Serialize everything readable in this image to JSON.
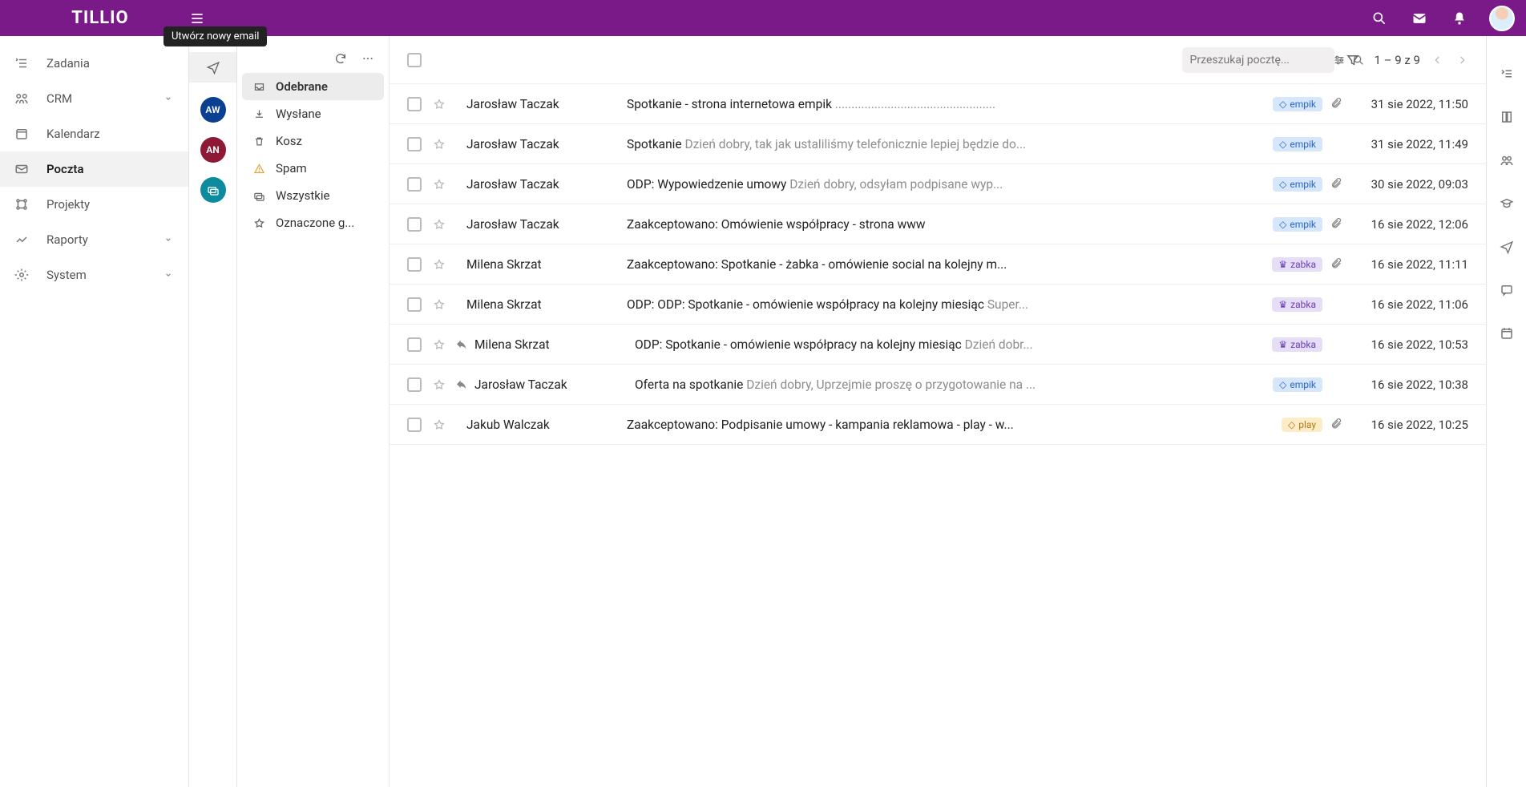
{
  "brand": "TILLIO",
  "tooltip": "Utwórz nowy email",
  "leftnav": [
    {
      "icon": "tasks",
      "label": "Zadania",
      "chev": false
    },
    {
      "icon": "crm",
      "label": "CRM",
      "chev": true
    },
    {
      "icon": "cal",
      "label": "Kalendarz",
      "chev": false
    },
    {
      "icon": "mail",
      "label": "Poczta",
      "chev": false,
      "active": true
    },
    {
      "icon": "proj",
      "label": "Projekty",
      "chev": false
    },
    {
      "icon": "rep",
      "label": "Raporty",
      "chev": true
    },
    {
      "icon": "sys",
      "label": "System",
      "chev": true
    }
  ],
  "accounts": [
    {
      "cls": "aw",
      "txt": "AW"
    },
    {
      "cls": "an",
      "txt": "AN"
    },
    {
      "cls": "mail",
      "txt": ""
    }
  ],
  "folders": [
    {
      "icon": "inbox",
      "label": "Odebrane",
      "active": true
    },
    {
      "icon": "sent",
      "label": "Wysłane"
    },
    {
      "icon": "trash",
      "label": "Kosz"
    },
    {
      "icon": "spam",
      "label": "Spam",
      "cls": "spam"
    },
    {
      "icon": "all",
      "label": "Wszystkie"
    },
    {
      "icon": "star",
      "label": "Oznaczone g..."
    }
  ],
  "search_placeholder": "Przeszukaj pocztę...",
  "pager": "1 – 9 z 9",
  "tags": {
    "empik": "empik",
    "zabka": "zabka",
    "play": "play"
  },
  "rows": [
    {
      "sender": "Jarosław Taczak",
      "subject": "Spotkanie - strona internetowa empik ",
      "preview": ".................................................",
      "tag": "empik",
      "clip": true,
      "date": "31 sie 2022, 11:50"
    },
    {
      "sender": "Jarosław Taczak",
      "subject": "Spotkanie ",
      "preview": "Dzień dobry, tak jak ustaliliśmy telefonicznie lepiej będzie do...",
      "tag": "empik",
      "clip": false,
      "date": "31 sie 2022, 11:49"
    },
    {
      "sender": "Jarosław Taczak",
      "subject": "ODP: Wypowiedzenie umowy ",
      "preview": "Dzień dobry, odsyłam podpisane wyp...",
      "tag": "empik",
      "clip": true,
      "date": "30 sie 2022, 09:03"
    },
    {
      "sender": "Jarosław Taczak",
      "subject": "Zaakceptowano: Omówienie współpracy - strona www",
      "preview": "",
      "tag": "empik",
      "clip": true,
      "date": "16 sie 2022, 12:06"
    },
    {
      "sender": "Milena Skrzat",
      "subject": "Zaakceptowano: Spotkanie - żabka - omówienie social na kolejny m...",
      "preview": "",
      "tag": "zabka",
      "clip": true,
      "date": "16 sie 2022, 11:11"
    },
    {
      "sender": "Milena Skrzat",
      "subject": "ODP: ODP: Spotkanie - omówienie współpracy na kolejny miesiąc ",
      "preview": "Super...",
      "tag": "zabka",
      "clip": false,
      "date": "16 sie 2022, 11:06"
    },
    {
      "sender": "Milena Skrzat",
      "subject": "ODP: Spotkanie - omówienie współpracy na kolejny miesiąc ",
      "preview": "Dzień dobr...",
      "tag": "zabka",
      "clip": false,
      "date": "16 sie 2022, 10:53",
      "reply": true
    },
    {
      "sender": "Jarosław Taczak",
      "subject": "Oferta na spotkanie ",
      "preview": "Dzień dobry, Uprzejmie proszę o przygotowanie na ...",
      "tag": "empik",
      "clip": false,
      "date": "16 sie 2022, 10:38",
      "reply": true
    },
    {
      "sender": "Jakub Walczak",
      "subject": "Zaakceptowano: Podpisanie umowy - kampania reklamowa - play - w...",
      "preview": "",
      "tag": "play",
      "clip": true,
      "date": "16 sie 2022, 10:25"
    }
  ]
}
